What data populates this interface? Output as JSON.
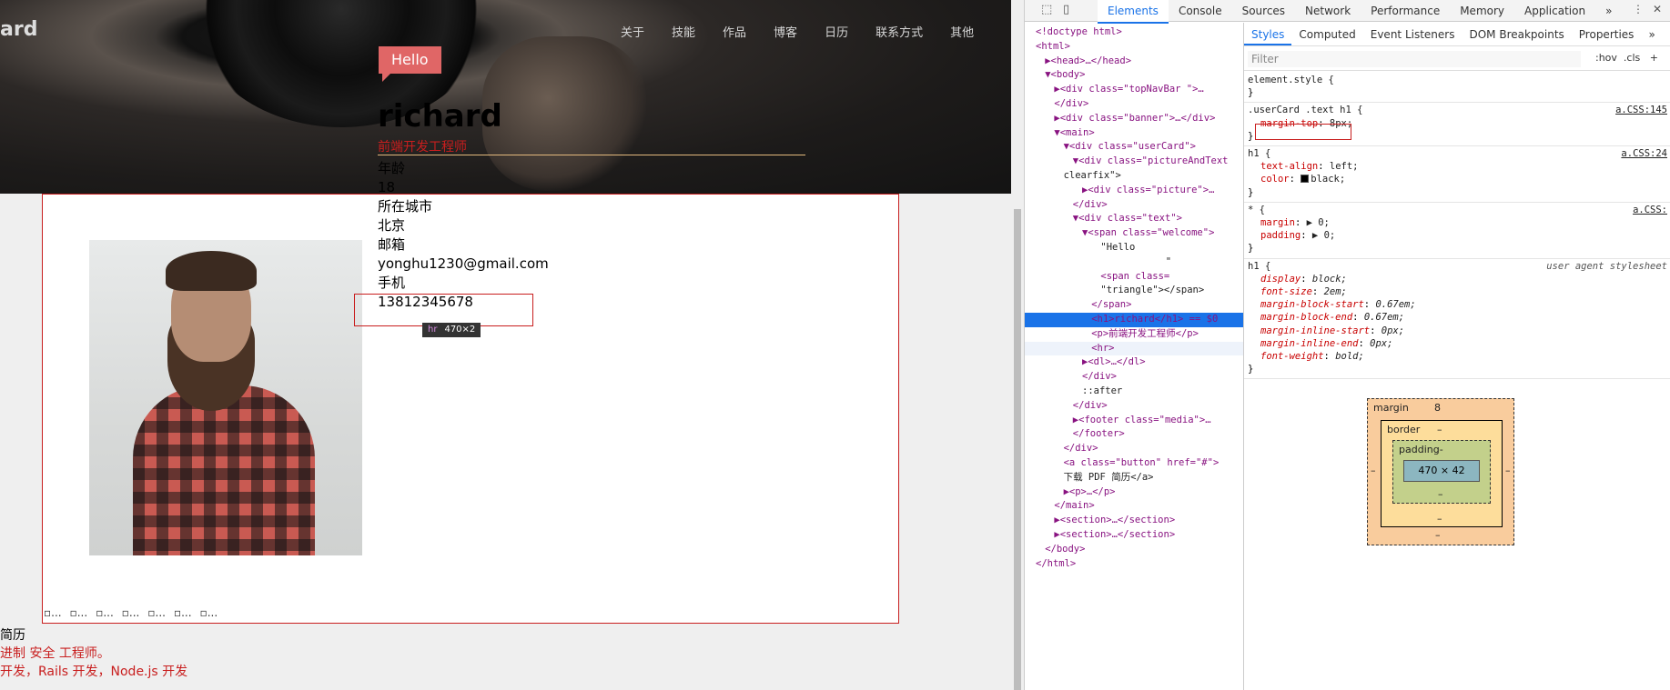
{
  "page": {
    "logo": "ard",
    "nav": [
      "关于",
      "技能",
      "作品",
      "博客",
      "日历",
      "联系方式",
      "其他"
    ],
    "welcome": "Hello",
    "name": "richard",
    "role": "前端开发工程师",
    "details": [
      "年龄",
      "18",
      "所在城市",
      "北京",
      "邮箱",
      "yonghu1230@gmail.com",
      "手机",
      "13812345678"
    ],
    "media_items": [
      "...",
      "...",
      "...",
      "...",
      "...",
      "...",
      "..."
    ],
    "hr_tooltip": {
      "tag": "hr",
      "size": "470×2"
    },
    "below_lines": [
      "简历",
      "进制 安全 工程师。",
      "开发，Rails 开发，Node.js 开发"
    ]
  },
  "devtools": {
    "tabs": [
      "Elements",
      "Console",
      "Sources",
      "Network",
      "Performance",
      "Memory",
      "Application"
    ],
    "active_tab": "Elements",
    "more": "»",
    "dom_tree": [
      {
        "depth": 0,
        "html": "<!doctype html>"
      },
      {
        "depth": 0,
        "html": "<html>"
      },
      {
        "depth": 1,
        "html": "▶<head>…</head>"
      },
      {
        "depth": 1,
        "html": "▼<body>"
      },
      {
        "depth": 2,
        "html": "▶<div class=\"topNavBar \">…"
      },
      {
        "depth": 2,
        "html": "</div>"
      },
      {
        "depth": 2,
        "html": "▶<div class=\"banner\">…</div>"
      },
      {
        "depth": 2,
        "html": "▼<main>"
      },
      {
        "depth": 3,
        "html": "▼<div class=\"userCard\">"
      },
      {
        "depth": 4,
        "html": "▼<div class=\"pictureAndText"
      },
      {
        "depth": 3,
        "html": "clearfix\">"
      },
      {
        "depth": 5,
        "html": "▶<div class=\"picture\">…"
      },
      {
        "depth": 4,
        "html": "</div>"
      },
      {
        "depth": 4,
        "html": "▼<div class=\"text\">"
      },
      {
        "depth": 5,
        "html": "▼<span class=\"welcome\">"
      },
      {
        "depth": 7,
        "html": "\"Hello"
      },
      {
        "depth": 14,
        "html": "\""
      },
      {
        "depth": 7,
        "html": "<span class="
      },
      {
        "depth": 7,
        "html": "\"triangle\"></span>"
      },
      {
        "depth": 6,
        "html": "</span>"
      },
      {
        "depth": 6,
        "html": "<h1>richard</h1> == $0"
      },
      {
        "depth": 6,
        "html": "<p>前端开发工程师</p>"
      },
      {
        "depth": 6,
        "html": "<hr>"
      },
      {
        "depth": 5,
        "html": "▶<dl>…</dl>"
      },
      {
        "depth": 5,
        "html": "</div>"
      },
      {
        "depth": 5,
        "html": "::after"
      },
      {
        "depth": 4,
        "html": "</div>"
      },
      {
        "depth": 4,
        "html": "▶<footer class=\"media\">…"
      },
      {
        "depth": 4,
        "html": "</footer>"
      },
      {
        "depth": 3,
        "html": "</div>"
      },
      {
        "depth": 3,
        "html": "<a class=\"button\" href=\"#\">"
      },
      {
        "depth": 3,
        "html": "下载 PDF 简历</a>"
      },
      {
        "depth": 3,
        "html": "▶<p>…</p>"
      },
      {
        "depth": 2,
        "html": "</main>"
      },
      {
        "depth": 2,
        "html": "▶<section>…</section>"
      },
      {
        "depth": 2,
        "html": "▶<section>…</section>"
      },
      {
        "depth": 1,
        "html": "</body>"
      },
      {
        "depth": 0,
        "html": "</html>"
      }
    ],
    "styles_tabs": [
      "Styles",
      "Computed",
      "Event Listeners",
      "DOM Breakpoints",
      "Properties"
    ],
    "filter_placeholder": "Filter",
    "hov": ":hov",
    "cls": ".cls",
    "plus": "+",
    "rules": [
      {
        "selector": "element.style {",
        "source": "",
        "props": [],
        "end": "}"
      },
      {
        "selector": ".userCard .text h1 {",
        "source": "a.CSS:145",
        "props": [
          [
            "margin-top",
            "8px;"
          ]
        ],
        "end": "}"
      },
      {
        "selector": "h1 {",
        "source": "a.CSS:24",
        "props": [
          [
            "text-align",
            "left;"
          ],
          [
            "color",
            "black;"
          ]
        ],
        "end": "}"
      },
      {
        "selector": "* {",
        "source": "a.CSS:",
        "props": [
          [
            "margin",
            "▶ 0;"
          ],
          [
            "padding",
            "▶ 0;"
          ]
        ],
        "end": "}"
      },
      {
        "selector": "h1 {",
        "source": "user agent stylesheet",
        "props": [
          [
            "display",
            "block;"
          ],
          [
            "font-size",
            "2em;"
          ],
          [
            "margin-block-start",
            "0.67em;"
          ],
          [
            "margin-block-end",
            "0.67em;"
          ],
          [
            "margin-inline-start",
            "0px;"
          ],
          [
            "margin-inline-end",
            "0px;"
          ],
          [
            "font-weight",
            "bold;"
          ]
        ],
        "end": "}"
      }
    ],
    "box_model": {
      "margin_label": "margin",
      "margin_top": "8",
      "margin_other": "–",
      "border_label": "border",
      "border_val": "–",
      "padding_label": "padding-",
      "padding_val": "–",
      "content": "470 × 42"
    },
    "colors": {
      "accent": "#1a73e8",
      "welcome_bg": "#e06666",
      "highlight": "#c81e1e"
    }
  }
}
